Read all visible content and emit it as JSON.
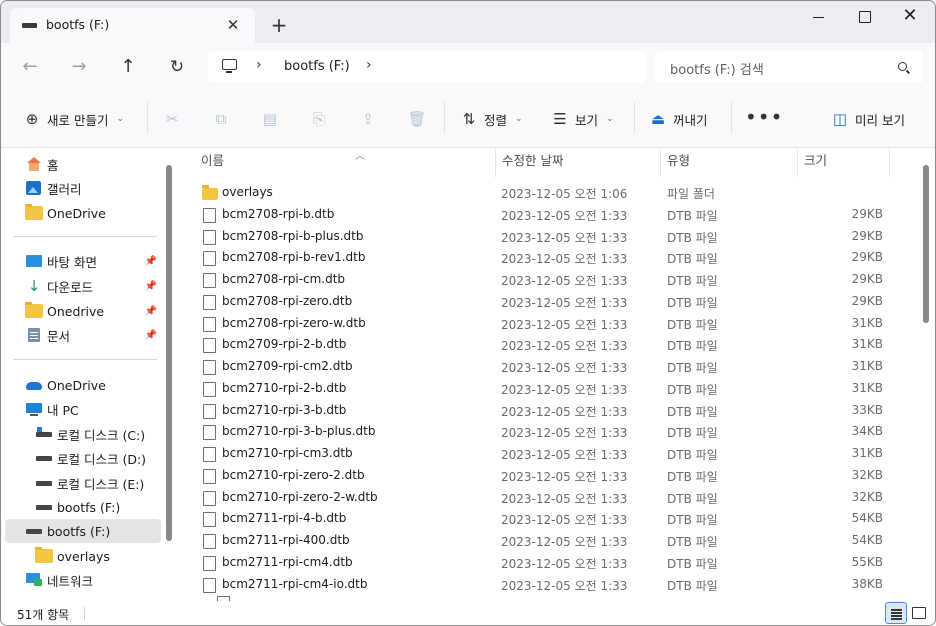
{
  "tab": {
    "title": "bootfs (F:)",
    "close": "✕",
    "new": "+"
  },
  "window": {
    "minimize": "",
    "maximize": "",
    "close": "✕"
  },
  "nav": {
    "back": "←",
    "forward": "→",
    "up": "↑",
    "refresh": "↻"
  },
  "address": {
    "crumb": "bootfs (F:)",
    "sep": "›"
  },
  "search": {
    "placeholder": "bootfs (F:) 검색"
  },
  "commands": {
    "new": "새로 만들기",
    "sort": "정렬",
    "view": "보기",
    "eject": "꺼내기",
    "more": "•••",
    "preview": "미리 보기"
  },
  "sidebar": {
    "home": "홈",
    "gallery": "갤러리",
    "onedrive_top": "OneDrive",
    "desktop": "바탕 화면",
    "downloads": "다운로드",
    "onedrive_pinned": "Onedrive",
    "documents": "문서",
    "onedrive_bottom": "OneDrive",
    "this_pc": "내 PC",
    "drive_c": "로컬 디스크 (C:)",
    "drive_d": "로컬 디스크 (D:)",
    "drive_e": "로컬 디스크 (E:)",
    "bootfs_sub": "bootfs (F:)",
    "bootfs": "bootfs (F:)",
    "overlays": "overlays",
    "network": "네트워크"
  },
  "columns": {
    "name": "이름",
    "date": "수정한 날짜",
    "type": "유형",
    "size": "크기"
  },
  "files": [
    {
      "name": "overlays",
      "date": "2023-12-05 오전 1:06",
      "type": "파일 폴더",
      "size": ""
    },
    {
      "name": "bcm2708-rpi-b.dtb",
      "date": "2023-12-05 오전 1:33",
      "type": "DTB 파일",
      "size": "29KB"
    },
    {
      "name": "bcm2708-rpi-b-plus.dtb",
      "date": "2023-12-05 오전 1:33",
      "type": "DTB 파일",
      "size": "29KB"
    },
    {
      "name": "bcm2708-rpi-b-rev1.dtb",
      "date": "2023-12-05 오전 1:33",
      "type": "DTB 파일",
      "size": "29KB"
    },
    {
      "name": "bcm2708-rpi-cm.dtb",
      "date": "2023-12-05 오전 1:33",
      "type": "DTB 파일",
      "size": "29KB"
    },
    {
      "name": "bcm2708-rpi-zero.dtb",
      "date": "2023-12-05 오전 1:33",
      "type": "DTB 파일",
      "size": "29KB"
    },
    {
      "name": "bcm2708-rpi-zero-w.dtb",
      "date": "2023-12-05 오전 1:33",
      "type": "DTB 파일",
      "size": "31KB"
    },
    {
      "name": "bcm2709-rpi-2-b.dtb",
      "date": "2023-12-05 오전 1:33",
      "type": "DTB 파일",
      "size": "31KB"
    },
    {
      "name": "bcm2709-rpi-cm2.dtb",
      "date": "2023-12-05 오전 1:33",
      "type": "DTB 파일",
      "size": "31KB"
    },
    {
      "name": "bcm2710-rpi-2-b.dtb",
      "date": "2023-12-05 오전 1:33",
      "type": "DTB 파일",
      "size": "31KB"
    },
    {
      "name": "bcm2710-rpi-3-b.dtb",
      "date": "2023-12-05 오전 1:33",
      "type": "DTB 파일",
      "size": "33KB"
    },
    {
      "name": "bcm2710-rpi-3-b-plus.dtb",
      "date": "2023-12-05 오전 1:33",
      "type": "DTB 파일",
      "size": "34KB"
    },
    {
      "name": "bcm2710-rpi-cm3.dtb",
      "date": "2023-12-05 오전 1:33",
      "type": "DTB 파일",
      "size": "31KB"
    },
    {
      "name": "bcm2710-rpi-zero-2.dtb",
      "date": "2023-12-05 오전 1:33",
      "type": "DTB 파일",
      "size": "32KB"
    },
    {
      "name": "bcm2710-rpi-zero-2-w.dtb",
      "date": "2023-12-05 오전 1:33",
      "type": "DTB 파일",
      "size": "32KB"
    },
    {
      "name": "bcm2711-rpi-4-b.dtb",
      "date": "2023-12-05 오전 1:33",
      "type": "DTB 파일",
      "size": "54KB"
    },
    {
      "name": "bcm2711-rpi-400.dtb",
      "date": "2023-12-05 오전 1:33",
      "type": "DTB 파일",
      "size": "54KB"
    },
    {
      "name": "bcm2711-rpi-cm4.dtb",
      "date": "2023-12-05 오전 1:33",
      "type": "DTB 파일",
      "size": "55KB"
    },
    {
      "name": "bcm2711-rpi-cm4-io.dtb",
      "date": "2023-12-05 오전 1:33",
      "type": "DTB 파일",
      "size": "38KB"
    }
  ],
  "status": {
    "count": "51개 항목"
  }
}
